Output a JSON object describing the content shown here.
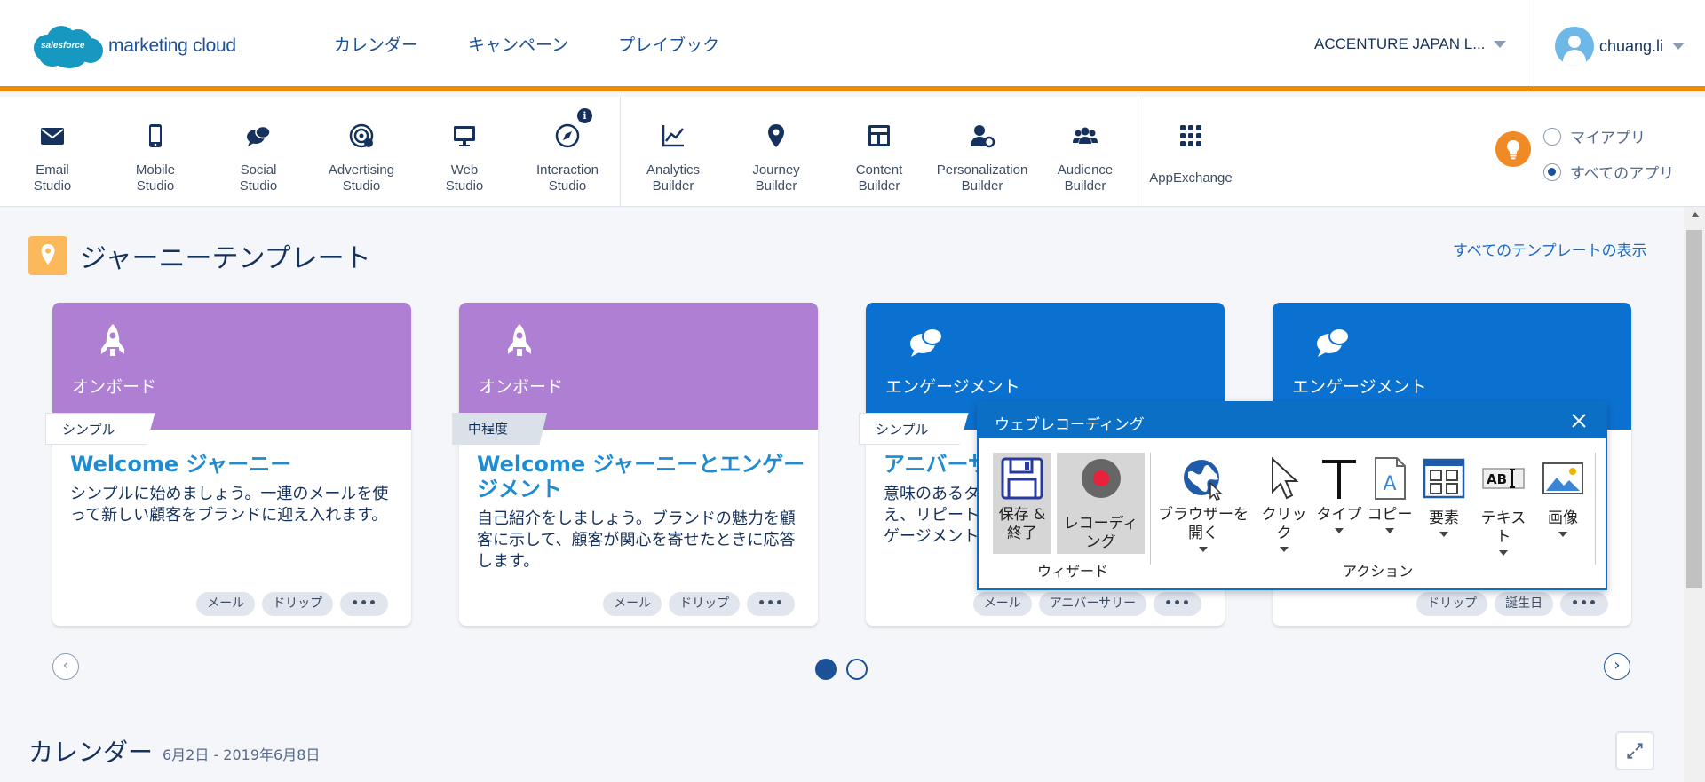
{
  "header": {
    "logo_badge": "salesforce",
    "logo_text": "marketing cloud",
    "nav": [
      "カレンダー",
      "キャンペーン",
      "プレイブック"
    ],
    "org_name": "ACCENTURE JAPAN L...",
    "username": "chuang.li"
  },
  "apps": [
    {
      "label": "Email\nStudio",
      "icon": "envelope-icon"
    },
    {
      "label": "Mobile\nStudio",
      "icon": "mobile-icon"
    },
    {
      "label": "Social\nStudio",
      "icon": "chat-bubbles-icon"
    },
    {
      "label": "Advertising\nStudio",
      "icon": "target-icon"
    },
    {
      "label": "Web\nStudio",
      "icon": "monitor-icon"
    },
    {
      "label": "Interaction\nStudio",
      "icon": "compass-icon"
    },
    {
      "label": "Analytics\nBuilder",
      "icon": "line-chart-icon"
    },
    {
      "label": "Journey\nBuilder",
      "icon": "map-pin-icon"
    },
    {
      "label": "Content\nBuilder",
      "icon": "layout-icon"
    },
    {
      "label": "Personalization\nBuilder",
      "icon": "person-gear-icon"
    },
    {
      "label": "Audience\nBuilder",
      "icon": "group-icon"
    },
    {
      "label": "AppExchange",
      "icon": "grid-icon"
    }
  ],
  "app_filter": {
    "options": [
      "マイアプリ",
      "すべてのアプリ"
    ],
    "selected": "すべてのアプリ"
  },
  "templates": {
    "title": "ジャーニーテンプレート",
    "view_all": "すべてのテンプレートの表示",
    "cards": [
      {
        "category": "オンボード",
        "level": "シンプル",
        "title": "Welcome ジャーニー",
        "description": "シンプルに始めましょう。一連のメールを使って新しい顧客をブランドに迎え入れます。",
        "tags": [
          "メール",
          "ドリップ",
          "•••"
        ],
        "color": "#ae7fd2"
      },
      {
        "category": "オンボード",
        "level": "中程度",
        "title": "Welcome ジャーニーとエンゲージメント",
        "description": "自己紹介をしましょう。ブランドの魅力を顧客に示して、顧客が関心を寄せたときに応答します。",
        "tags": [
          "メール",
          "ドリップ",
          "•••"
        ],
        "color": "#ae7fd2"
      },
      {
        "category": "エンゲージメント",
        "level": "シンプル",
        "title": "アニバーサ",
        "description": "意味のあるタ え、リピート ゲージメント",
        "tags": [
          "メール",
          "アニバーサリー",
          "•••"
        ],
        "color": "#0b71d0"
      },
      {
        "category": "エンゲージメント",
        "level": "",
        "title": "",
        "description": "",
        "tags": [
          "ドリップ",
          "誕生日",
          "•••"
        ],
        "color": "#0b71d0"
      }
    ],
    "page": 1,
    "page_count": 2
  },
  "calendar": {
    "title": "カレンダー",
    "range": "6月2日 - 2019年6月8日"
  },
  "recorder": {
    "title": "ウェブレコーディング",
    "wizard_group": "ウィザード",
    "action_group": "アクション",
    "save_label": "保存 &\n終了",
    "record_label": "レコーディング",
    "actions": [
      "ブラウザーを開く",
      "クリック",
      "タイプ",
      "コピー",
      "要素",
      "テキスト",
      "画像"
    ]
  }
}
